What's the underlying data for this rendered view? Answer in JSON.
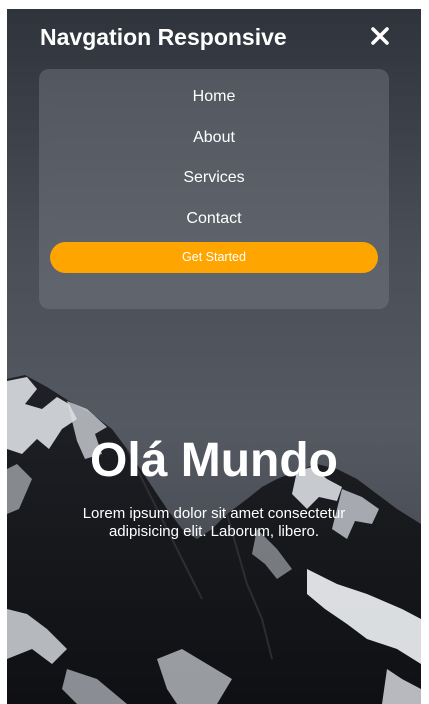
{
  "header": {
    "brand": "Navgation Responsive",
    "close_icon": "close-icon"
  },
  "menu": {
    "items": [
      {
        "label": "Home"
      },
      {
        "label": "About"
      },
      {
        "label": "Services"
      },
      {
        "label": "Contact"
      }
    ],
    "cta_label": "Get Started"
  },
  "hero": {
    "title": "Olá Mundo",
    "text": "Lorem ipsum dolor sit amet consectetur adipisicing elit. Laborum, libero."
  },
  "colors": {
    "accent": "#ffa500",
    "text": "#ffffff",
    "background": "#4a4e57"
  }
}
